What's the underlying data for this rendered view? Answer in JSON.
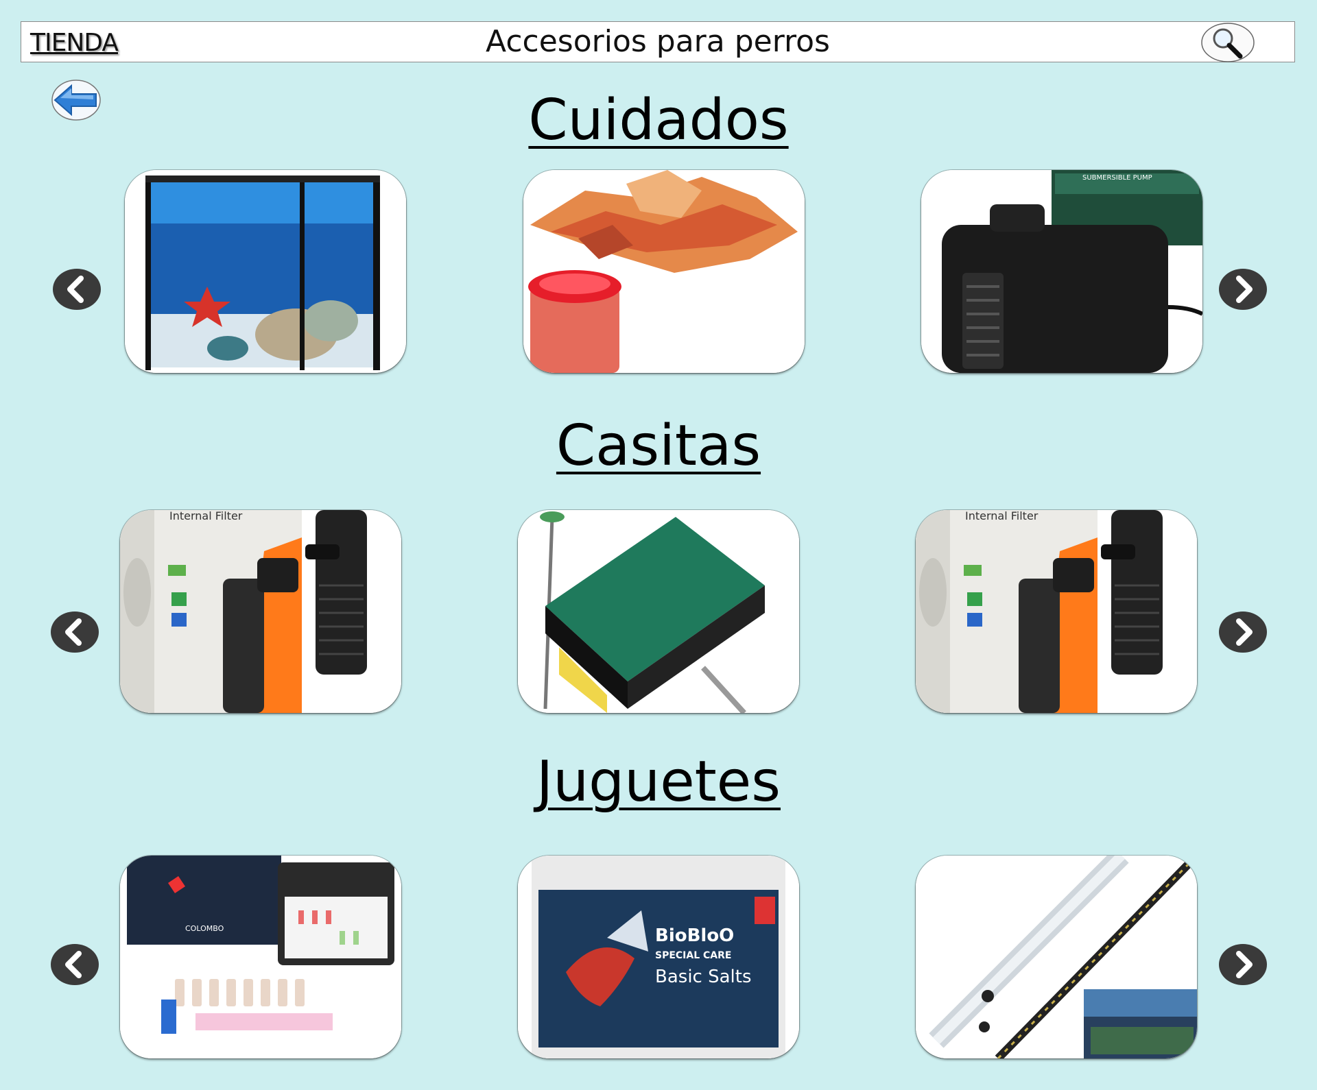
{
  "header": {
    "store_link": "TIENDA",
    "title": "Accesorios para perros",
    "search_icon": "magnifier-icon",
    "back_icon": "back-arrow-icon"
  },
  "sections": [
    {
      "title": "Cuidados",
      "products": [
        {
          "image": "aquarium-tank"
        },
        {
          "image": "fish-food-flakes"
        },
        {
          "image": "submersible-pump",
          "image_text": "SUBMERSIBLE PUMP"
        }
      ]
    },
    {
      "title": "Casitas",
      "products": [
        {
          "image": "internal-filter",
          "image_text": "Internal Filter"
        },
        {
          "image": "algae-scraper-sponge"
        },
        {
          "image": "internal-filter",
          "image_text": "Internal Filter"
        }
      ]
    },
    {
      "title": "Juguetes",
      "products": [
        {
          "image": "water-test-kit",
          "image_text": "COLOMBO"
        },
        {
          "image": "biobloo-basic-salts",
          "image_text_1": "BioBloO",
          "image_text_2": "SPECIAL CARE",
          "image_text_3": "Basic Salts"
        },
        {
          "image": "led-aquarium-light"
        }
      ]
    }
  ],
  "carousel": {
    "prev_icon": "chevron-left-icon",
    "next_icon": "chevron-right-icon"
  },
  "colors": {
    "background": "#cdeff0",
    "arrow": "#3a3a3a",
    "back_arrow": "#2f7fd6"
  }
}
